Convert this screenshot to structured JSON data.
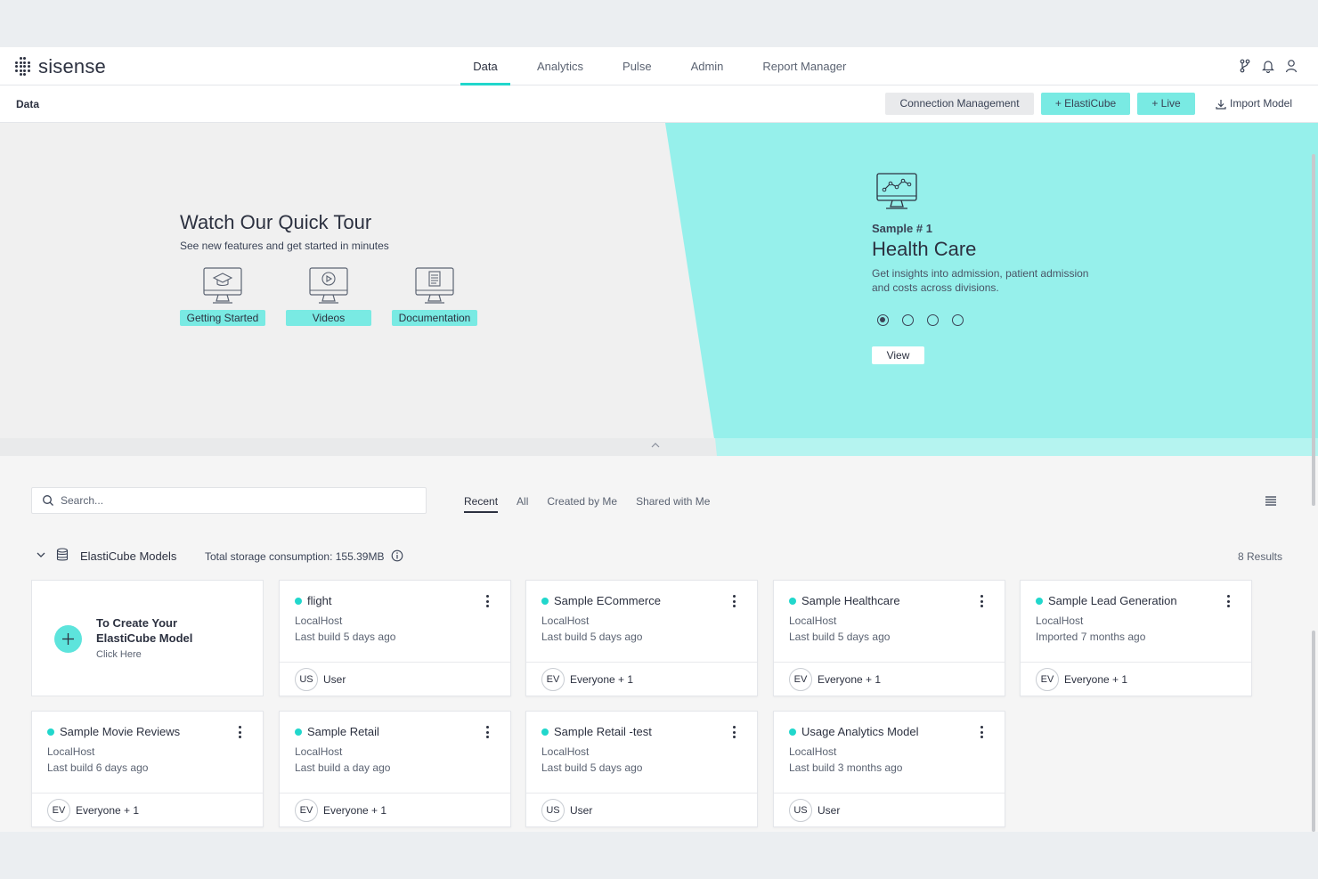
{
  "brand": {
    "name": "sisense",
    "accent": "#21d7cc"
  },
  "nav": {
    "tabs": [
      {
        "label": "Data",
        "active": true
      },
      {
        "label": "Analytics",
        "active": false
      },
      {
        "label": "Pulse",
        "active": false
      },
      {
        "label": "Admin",
        "active": false
      },
      {
        "label": "Report Manager",
        "active": false
      }
    ],
    "icons": [
      "git-branch-icon",
      "bell-icon",
      "user-icon"
    ]
  },
  "subheader": {
    "title": "Data",
    "connection_management": "Connection Management",
    "add_elasticube": "+ ElastiCube",
    "add_live": "+ Live",
    "import_model": "Import Model"
  },
  "hero": {
    "tour_title": "Watch Our Quick Tour",
    "tour_subtitle": "See new features and get started in minutes",
    "tour_items": [
      {
        "label": "Getting Started",
        "icon": "graduation-cap-monitor-icon"
      },
      {
        "label": "Videos",
        "icon": "play-monitor-icon"
      },
      {
        "label": "Documentation",
        "icon": "document-monitor-icon"
      }
    ],
    "sample": {
      "number": "Sample # 1",
      "title": "Health Care",
      "description": "Get insights into admission, patient admission and costs across divisions.",
      "view_label": "View",
      "active_index": 0,
      "total": 4
    }
  },
  "search": {
    "placeholder": "Search..."
  },
  "filters": [
    {
      "label": "Recent",
      "active": true
    },
    {
      "label": "All",
      "active": false
    },
    {
      "label": "Created by Me",
      "active": false
    },
    {
      "label": "Shared with Me",
      "active": false
    }
  ],
  "section": {
    "name": "ElastiCube Models",
    "storage": "Total storage consumption: 155.39MB",
    "results": "8 Results"
  },
  "create_card": {
    "title": "To Create Your ElastiCube Model",
    "subtitle": "Click Here"
  },
  "models": [
    {
      "name": "flight",
      "host": "LocalHost",
      "build": "Last build 5 days ago",
      "avatar": "US",
      "owner": "User"
    },
    {
      "name": "Sample ECommerce",
      "host": "LocalHost",
      "build": "Last build 5 days ago",
      "avatar": "EV",
      "owner": "Everyone + 1"
    },
    {
      "name": "Sample Healthcare",
      "host": "LocalHost",
      "build": "Last build 5 days ago",
      "avatar": "EV",
      "owner": "Everyone + 1"
    },
    {
      "name": "Sample Lead Generation",
      "host": "LocalHost",
      "build": "Imported 7 months ago",
      "avatar": "EV",
      "owner": "Everyone + 1"
    },
    {
      "name": "Sample Movie Reviews",
      "host": "LocalHost",
      "build": "Last build 6 days ago",
      "avatar": "EV",
      "owner": "Everyone + 1"
    },
    {
      "name": "Sample Retail",
      "host": "LocalHost",
      "build": "Last build a day ago",
      "avatar": "EV",
      "owner": "Everyone + 1"
    },
    {
      "name": "Sample Retail -test",
      "host": "LocalHost",
      "build": "Last build 5 days ago",
      "avatar": "US",
      "owner": "User"
    },
    {
      "name": "Usage Analytics Model",
      "host": "LocalHost",
      "build": "Last build 3 months ago",
      "avatar": "US",
      "owner": "User"
    }
  ]
}
